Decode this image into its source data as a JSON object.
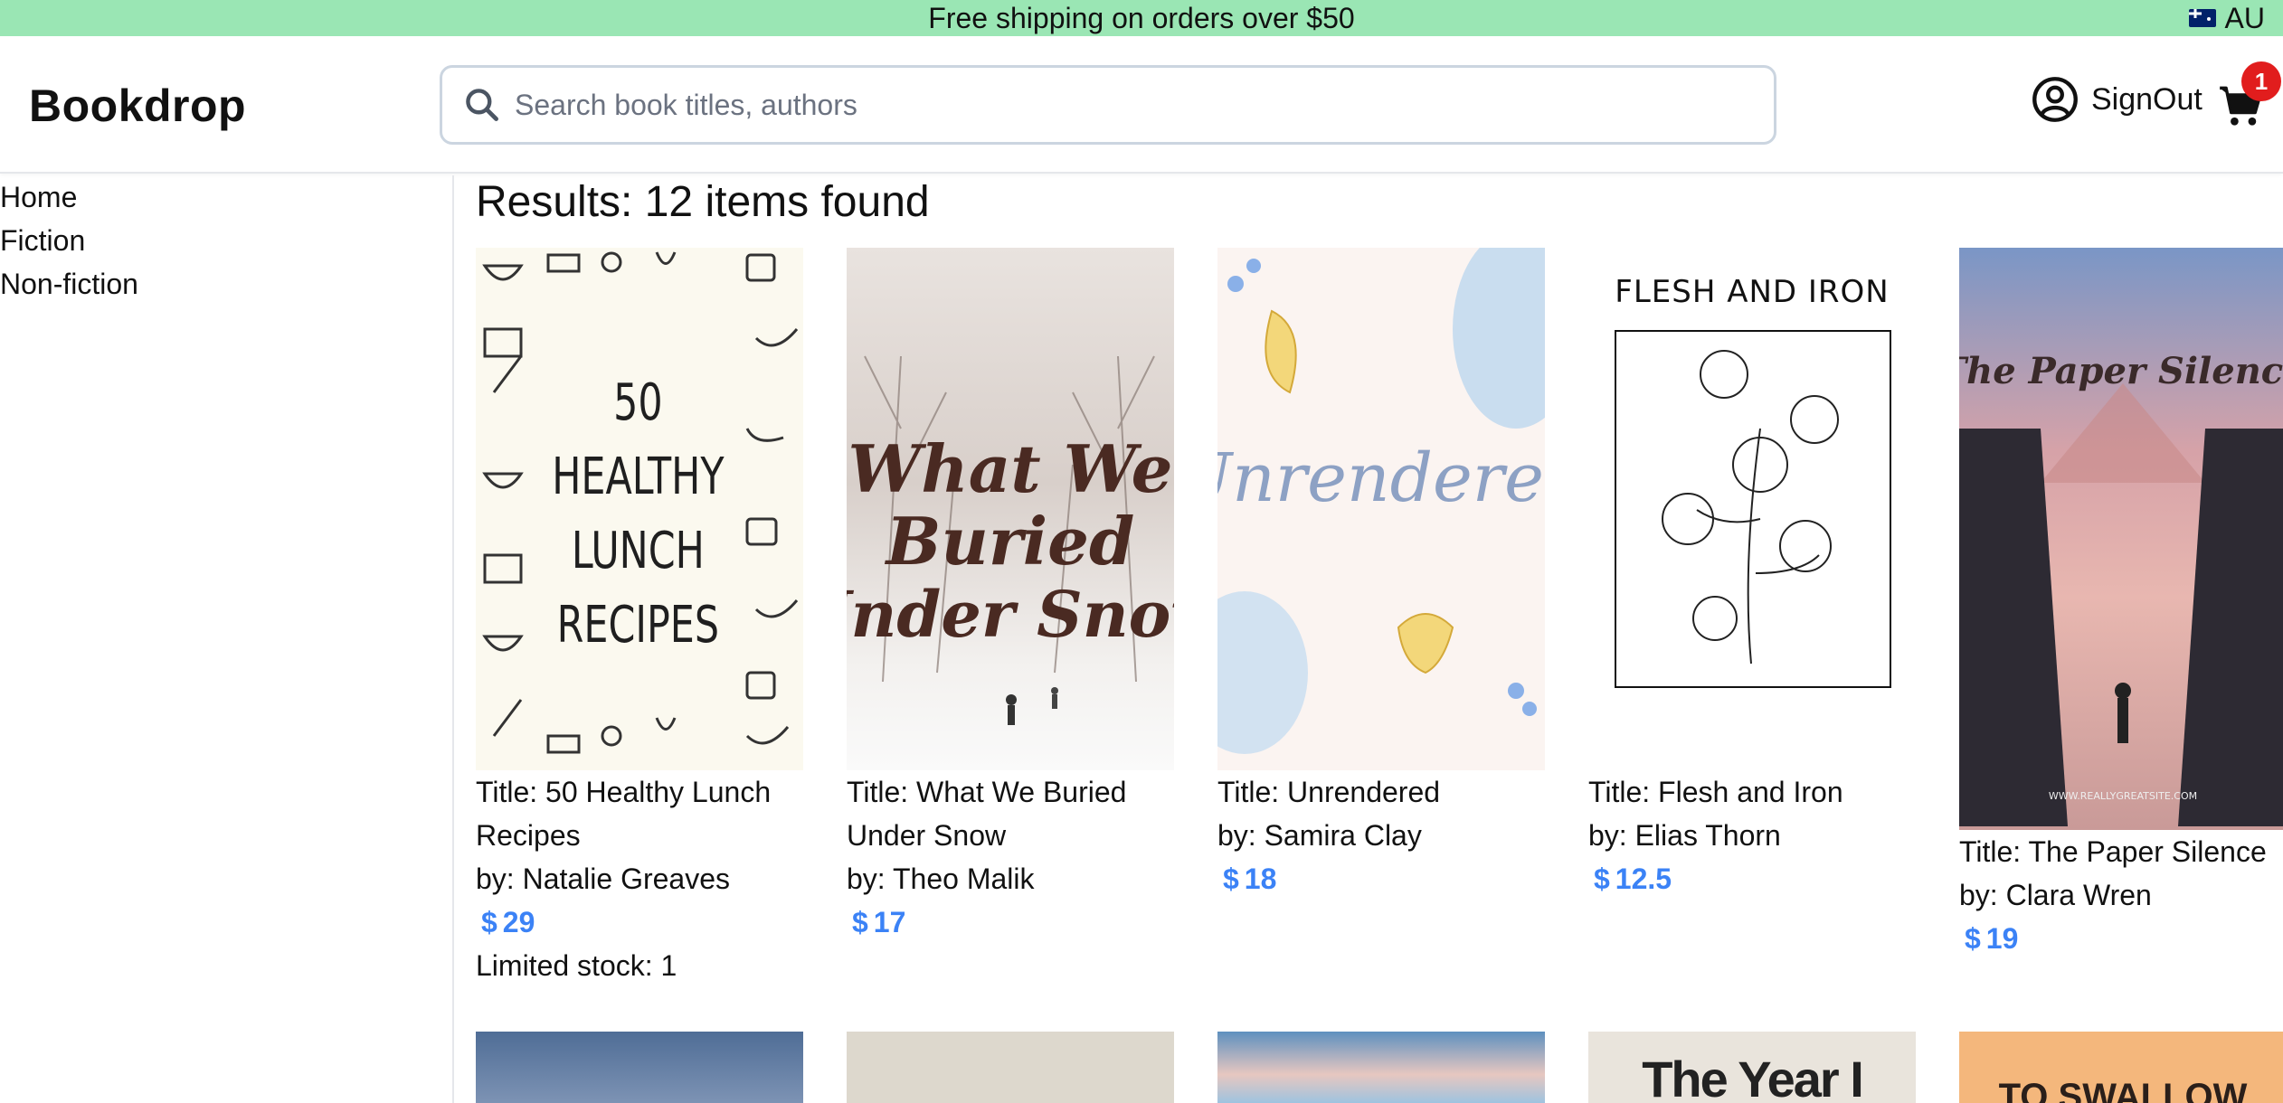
{
  "announcement": {
    "text": "Free shipping on orders over $50",
    "region": "AU"
  },
  "header": {
    "logo": "Bookdrop",
    "search_placeholder": "Search book titles, authors",
    "signout_label": "SignOut",
    "cart_count": "1"
  },
  "sidebar": {
    "items": [
      {
        "label": "Home"
      },
      {
        "label": "Fiction"
      },
      {
        "label": "Non-fiction"
      }
    ]
  },
  "main": {
    "results_label": "Results: 12 items found",
    "currency": "$",
    "books": [
      {
        "title_line1": "Title: 50 Healthy Lunch",
        "title_line2": "Recipes",
        "author": "by: Natalie Greaves",
        "price": "29",
        "stock": "Limited stock: 1",
        "cover_text": [
          "50",
          "HEALTHY",
          "LUNCH",
          "RECIPES"
        ]
      },
      {
        "title_line1": "Title: What We Buried",
        "title_line2": "Under Snow",
        "author": "by: Theo Malik",
        "price": "17",
        "cover_text": [
          "What We",
          "Buried",
          "Under Snow"
        ]
      },
      {
        "title_line1": "Title: Unrendered",
        "author": "by: Samira Clay",
        "price": "18",
        "cover_text": [
          "Unrendered"
        ]
      },
      {
        "title_line1": "Title: Flesh and Iron",
        "author": "by: Elias Thorn",
        "price": "12.5",
        "cover_text": [
          "FLESH AND IRON"
        ]
      },
      {
        "title_line1": "Title: The Paper Silence",
        "author": "by: Clara Wren",
        "price": "19",
        "cover_text": [
          "The Paper Silence",
          "WWW.REALLYGREATSITE.COM"
        ]
      }
    ],
    "second_row_cover_text": [
      "The Year I",
      "TO SWALLOW"
    ]
  },
  "colors": {
    "announcement_bg": "#9ae6b4",
    "price": "#3b82f6",
    "badge": "#e11d1d"
  }
}
